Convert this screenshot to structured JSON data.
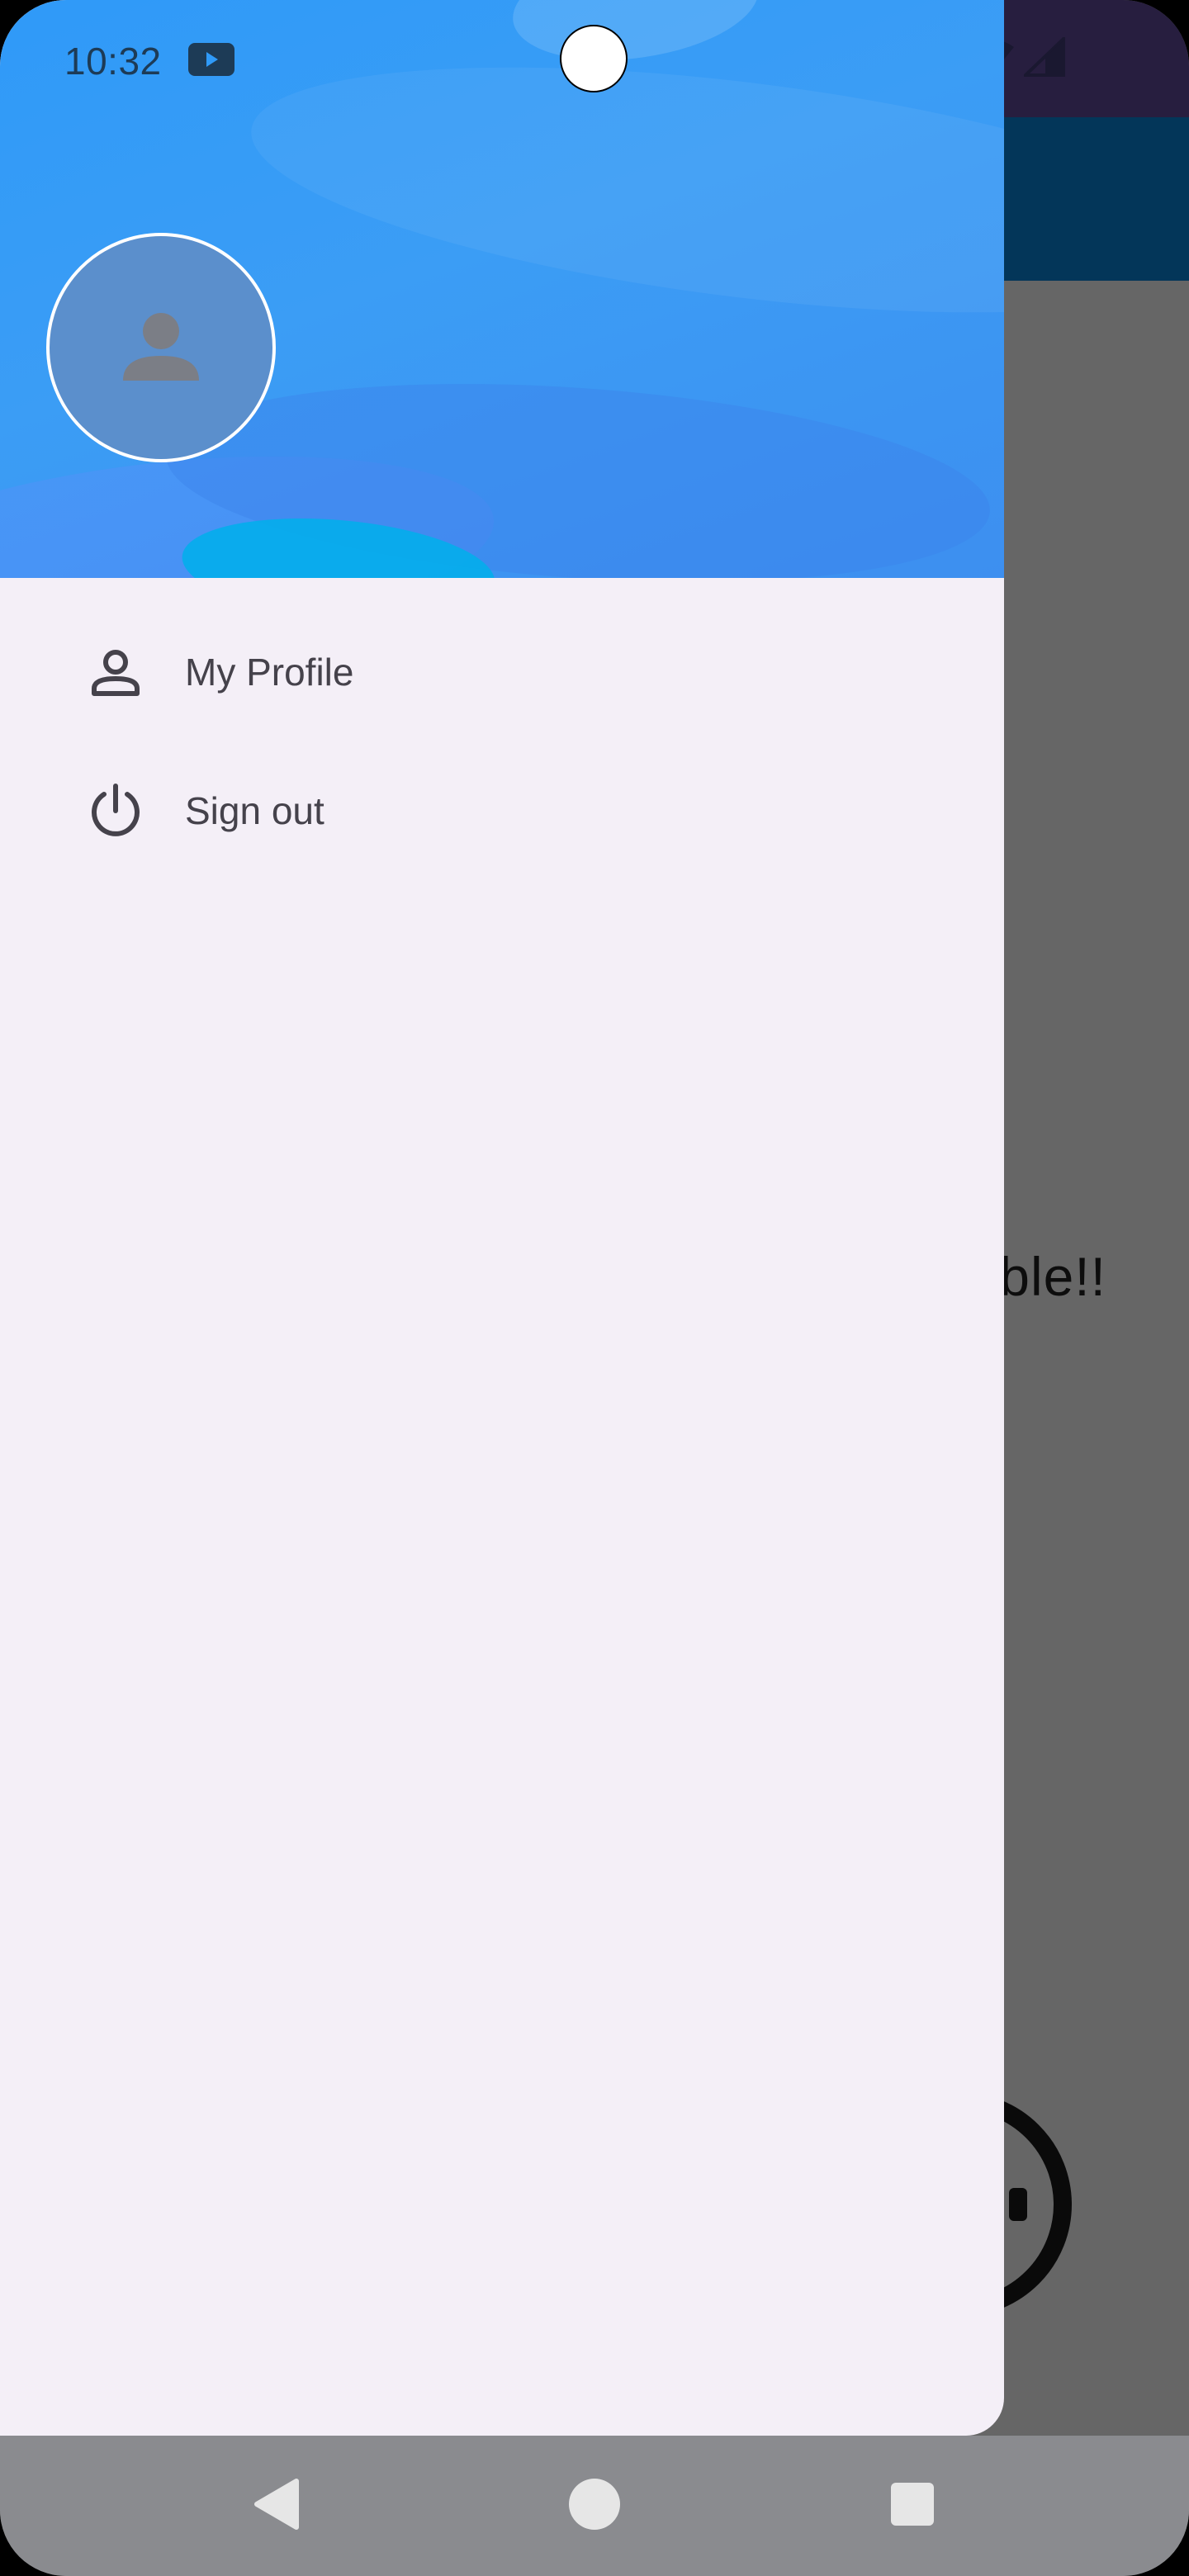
{
  "status_bar": {
    "time": "10:32",
    "notification_icon": "youtube-icon",
    "right_icons": [
      "wifi-icon",
      "signal-icon"
    ]
  },
  "background_app": {
    "body_text_partial": "ble!!",
    "colors": {
      "status_bar": "#271e3f",
      "app_bar": "#033659",
      "body_scrim": "#666666"
    }
  },
  "drawer": {
    "header": {
      "avatar_icon": "person-icon"
    },
    "menu": [
      {
        "icon": "person-outline-icon",
        "label": "My Profile"
      },
      {
        "icon": "power-icon",
        "label": "Sign out"
      }
    ],
    "colors": {
      "header": "#2f9af8",
      "background": "#f4eff7",
      "text": "#45424b"
    }
  },
  "nav_bar": {
    "buttons": [
      "back-icon",
      "home-icon",
      "recents-icon"
    ],
    "color": "#8a8b8f"
  }
}
